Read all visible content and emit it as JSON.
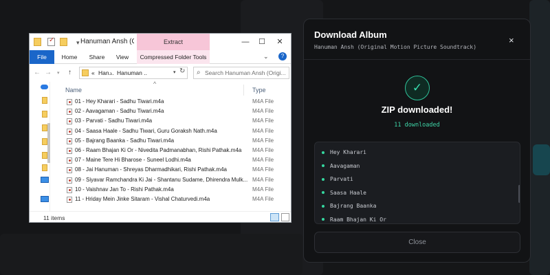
{
  "explorer": {
    "title": "Hanuman Ansh (Origi...",
    "extract_tab": "Extract",
    "ribbon_tabs": [
      "File",
      "Home",
      "Share",
      "View",
      "Compressed Folder Tools"
    ],
    "address": {
      "crumb_prefix": "«",
      "crumbs": [
        "Han...",
        "Hanuman ..."
      ]
    },
    "search_placeholder": "Search Hanuman Ansh (Origi...",
    "columns": {
      "name": "Name",
      "type": "Type"
    },
    "files": [
      {
        "name": "01 - Hey Kharari - Sadhu Tiwari.m4a",
        "type": "M4A File"
      },
      {
        "name": "02 - Aavagaman - Sadhu Tiwari.m4a",
        "type": "M4A File"
      },
      {
        "name": "03 - Parvati - Sadhu Tiwari.m4a",
        "type": "M4A File"
      },
      {
        "name": "04 - Saasa Haale - Sadhu Tiwari, Guru Goraksh Nath.m4a",
        "type": "M4A File"
      },
      {
        "name": "05 - Bajrang Baanka - Sadhu Tiwari.m4a",
        "type": "M4A File"
      },
      {
        "name": "06 - Raam Bhajan Ki Or - Nivedita Padmanabhan, Rishi Pathak.m4a",
        "type": "M4A File"
      },
      {
        "name": "07 - Maine Tere Hi Bharose - Suneel Lodhi.m4a",
        "type": "M4A File"
      },
      {
        "name": "08 - Jai Hanuman - Shreyas Dharmadhikari, Rishi Pathak.m4a",
        "type": "M4A File"
      },
      {
        "name": "09 - Siyavar Ramchandra Ki Jai - Shantanu Sudame, Dhirendra Mulk...",
        "type": "M4A File"
      },
      {
        "name": "10 - Vaishnav Jan To - Rishi Pathak.m4a",
        "type": "M4A File"
      },
      {
        "name": "11 - Hriday Mein Jinke Sitaram - Vishal Chaturvedi.m4a",
        "type": "M4A File"
      }
    ],
    "status": "11 items"
  },
  "modal": {
    "title": "Download Album",
    "subtitle": "Hanuman Ansh (Original Motion Picture Soundtrack)",
    "close_icon": "×",
    "success_icon": "✓",
    "success_title": "ZIP downloaded!",
    "download_count": "11 downloaded",
    "tracks": [
      "Hey Kharari",
      "Aavagaman",
      "Parvati",
      "Saasa Haale",
      "Bajrang Baanka",
      "Raam Bhajan Ki Or"
    ],
    "close_button": "Close",
    "accent_color": "#35d79f"
  }
}
